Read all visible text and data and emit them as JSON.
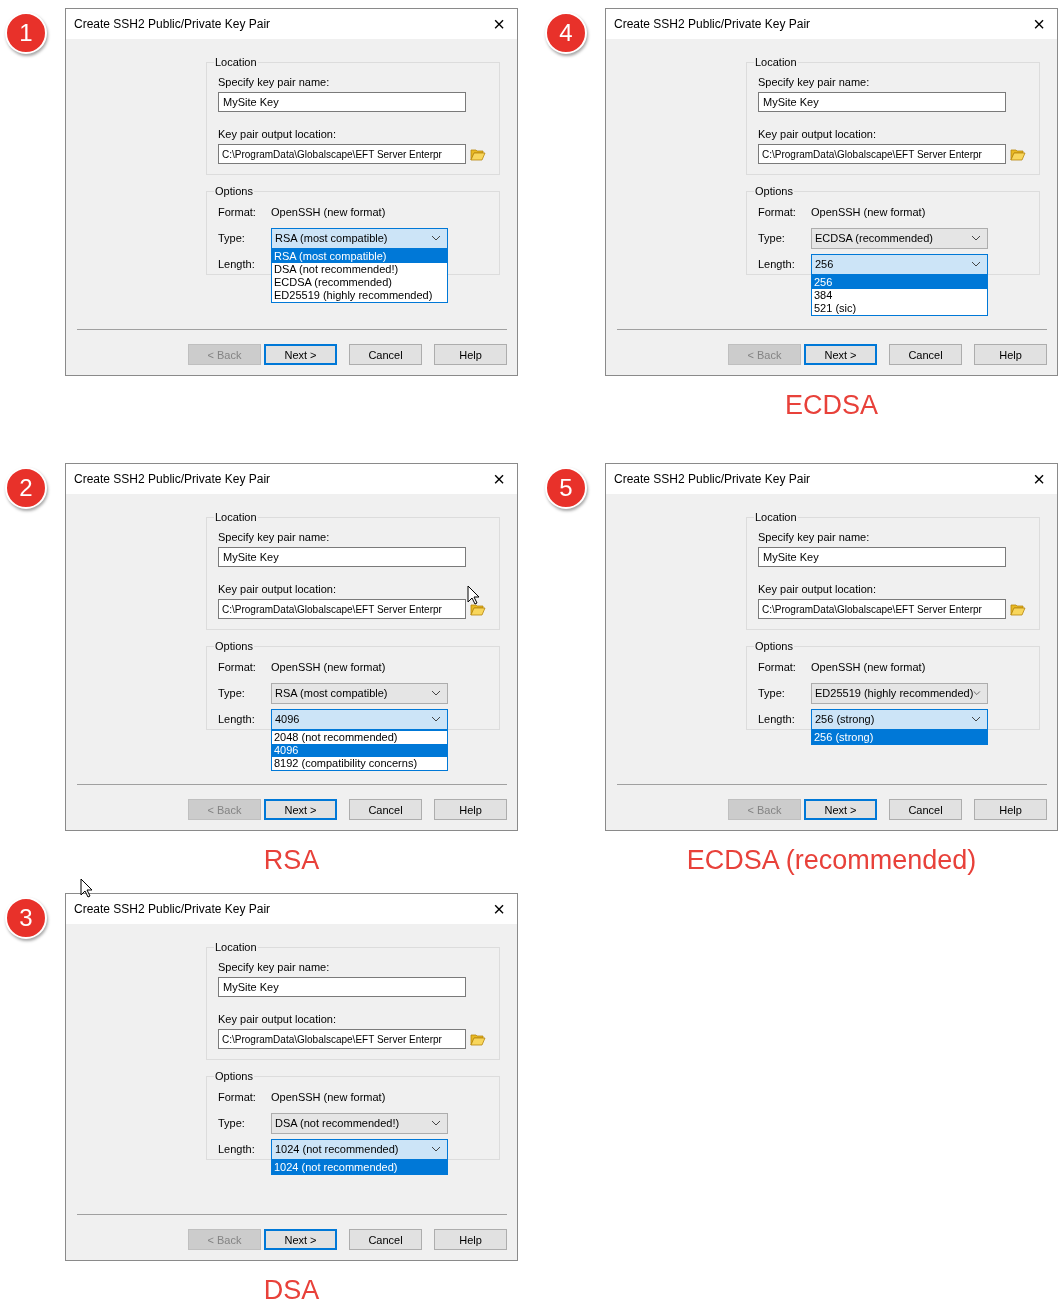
{
  "panels": [
    {
      "number": "1",
      "dialog": {
        "title": "Create SSH2 Public/Private Key Pair",
        "close": "×",
        "location_label": "Location",
        "name_label": "Specify key pair name:",
        "name_value": "MySite Key",
        "output_label": "Key pair output location:",
        "output_value": "C:\\ProgramData\\Globalscape\\EFT Server Enterpr",
        "options_label": "Options",
        "format_label": "Format:",
        "format_value": "OpenSSH (new format)",
        "type": {
          "label": "Type:",
          "value": "RSA (most compatible)",
          "items": [
            {
              "label": "RSA (most compatible)",
              "selected": true
            },
            {
              "label": "DSA (not recommended!)",
              "selected": false
            },
            {
              "label": "ECDSA (recommended)",
              "selected": false
            },
            {
              "label": "ED25519 (highly recommended)",
              "selected": false
            }
          ]
        },
        "length": {
          "label": "Length:"
        },
        "buttons": [
          {
            "label": "< Back",
            "disabled": true,
            "default": false
          },
          {
            "label": "Next >",
            "disabled": false,
            "default": true
          },
          {
            "label": "Cancel",
            "disabled": false,
            "default": false
          },
          {
            "label": "Help",
            "disabled": false,
            "default": false
          }
        ]
      }
    },
    {
      "number": "4",
      "caption": "ECDSA",
      "dialog": {
        "title": "Create SSH2 Public/Private Key Pair",
        "close": "×",
        "location_label": "Location",
        "name_label": "Specify key pair name:",
        "name_value": "MySite Key",
        "output_label": "Key pair output location:",
        "output_value": "C:\\ProgramData\\Globalscape\\EFT Server Enterpr",
        "options_label": "Options",
        "format_label": "Format:",
        "format_value": "OpenSSH (new format)",
        "type": {
          "label": "Type:",
          "value": "ECDSA (recommended)"
        },
        "length": {
          "label": "Length:",
          "value": "256",
          "items": [
            {
              "label": "256",
              "selected": true
            },
            {
              "label": "384",
              "selected": false
            },
            {
              "label": "521 (sic)",
              "selected": false
            }
          ]
        },
        "buttons": [
          {
            "label": "< Back",
            "disabled": true,
            "default": false
          },
          {
            "label": "Next >",
            "disabled": false,
            "default": true
          },
          {
            "label": "Cancel",
            "disabled": false,
            "default": false
          },
          {
            "label": "Help",
            "disabled": false,
            "default": false
          }
        ]
      }
    },
    {
      "number": "2",
      "folder_pointer": true,
      "caption": "RSA",
      "dialog": {
        "title": "Create SSH2 Public/Private Key Pair",
        "close": "×",
        "location_label": "Location",
        "name_label": "Specify key pair name:",
        "name_value": "MySite Key",
        "output_label": "Key pair output location:",
        "output_value": "C:\\ProgramData\\Globalscape\\EFT Server Enterpr",
        "options_label": "Options",
        "format_label": "Format:",
        "format_value": "OpenSSH (new format)",
        "type": {
          "label": "Type:",
          "value": "RSA (most compatible)"
        },
        "length": {
          "label": "Length:",
          "value": "4096",
          "items": [
            {
              "label": "2048 (not recommended)",
              "selected": false
            },
            {
              "label": "4096",
              "selected": true
            },
            {
              "label": "8192 (compatibility concerns)",
              "selected": false
            }
          ]
        },
        "buttons": [
          {
            "label": "< Back",
            "disabled": true,
            "default": false
          },
          {
            "label": "Next >",
            "disabled": false,
            "default": true
          },
          {
            "label": "Cancel",
            "disabled": false,
            "default": false
          },
          {
            "label": "Help",
            "disabled": false,
            "default": false
          }
        ]
      }
    },
    {
      "number": "5",
      "caption": "ECDSA (recommended)",
      "dialog": {
        "title": "Create SSH2 Public/Private Key Pair",
        "close": "×",
        "location_label": "Location",
        "name_label": "Specify key pair name:",
        "name_value": "MySite Key",
        "output_label": "Key pair output location:",
        "output_value": "C:\\ProgramData\\Globalscape\\EFT Server Enterpr",
        "options_label": "Options",
        "format_label": "Format:",
        "format_value": "OpenSSH (new format)",
        "type": {
          "label": "Type:",
          "value": "ED25519 (highly recommended)"
        },
        "length": {
          "label": "Length:",
          "value": "256 (strong)",
          "items": [
            {
              "label": "256 (strong)",
              "selected": true
            }
          ]
        },
        "buttons": [
          {
            "label": "< Back",
            "disabled": true,
            "default": false
          },
          {
            "label": "Next >",
            "disabled": false,
            "default": true
          },
          {
            "label": "Cancel",
            "disabled": false,
            "default": false
          },
          {
            "label": "Help",
            "disabled": false,
            "default": false
          }
        ]
      }
    },
    {
      "number": "3",
      "top_pointer": true,
      "caption": "DSA",
      "dialog": {
        "title": "Create SSH2 Public/Private Key Pair",
        "close": "×",
        "location_label": "Location",
        "name_label": "Specify key pair name:",
        "name_value": "MySite Key",
        "output_label": "Key pair output location:",
        "output_value": "C:\\ProgramData\\Globalscape\\EFT Server Enterpr",
        "options_label": "Options",
        "format_label": "Format:",
        "format_value": "OpenSSH (new format)",
        "type": {
          "label": "Type:",
          "value": "DSA (not recommended!)"
        },
        "length": {
          "label": "Length:",
          "value": "1024 (not recommended)",
          "items": [
            {
              "label": "1024 (not recommended)",
              "selected": true
            }
          ]
        },
        "buttons": [
          {
            "label": "< Back",
            "disabled": true,
            "default": false
          },
          {
            "label": "Next >",
            "disabled": false,
            "default": true
          },
          {
            "label": "Cancel",
            "disabled": false,
            "default": false
          },
          {
            "label": "Help",
            "disabled": false,
            "default": false
          }
        ]
      }
    }
  ]
}
